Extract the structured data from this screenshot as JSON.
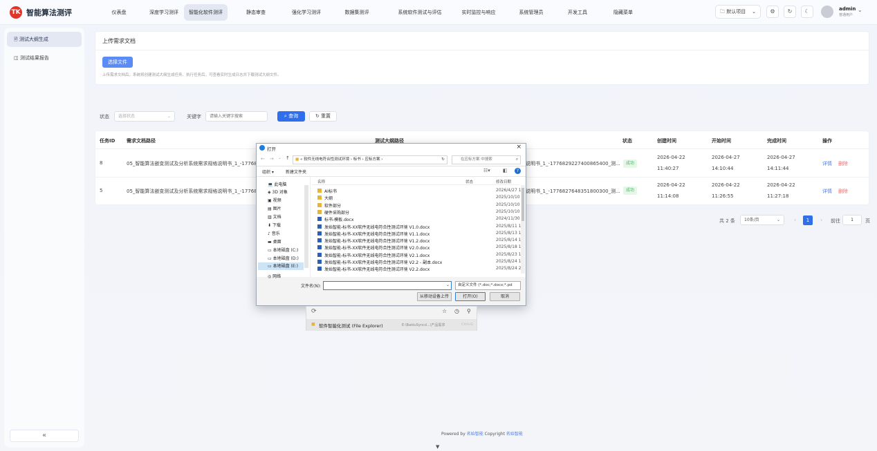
{
  "app": {
    "logo_text": "TK",
    "title": "智能算法测评"
  },
  "nav": [
    "仪表盘",
    "深度学习测评",
    "智能化软件测评",
    "静态审查",
    "强化学习测评",
    "数据集测评",
    "系统软件测试与评估",
    "实时监控与响应",
    "系统管理员",
    "开发工具",
    "隐藏菜单"
  ],
  "nav_active": "智能化软件测评",
  "project": {
    "label": "默认项目",
    "icon": "folder-icon"
  },
  "user": {
    "name": "admin",
    "role": "普通用户"
  },
  "sidebar": {
    "items": [
      "测试大纲生成",
      "测试结果报告"
    ],
    "collapse": "«"
  },
  "upload": {
    "title": "上传需求文档",
    "button": "选择文件",
    "hint": "上传需求文档后，系统将创建测试大纲生成任务、执行任务后，可查看实时生成日志并下载测试大纲文件。"
  },
  "filters": {
    "status_label": "状态",
    "status_placeholder": "选择状态",
    "keyword_label": "关键字",
    "keyword_placeholder": "请输入关键字搜索",
    "search": "查询",
    "reset": "重置"
  },
  "table": {
    "headers": [
      "任务ID",
      "需求文档路径",
      "测试大纲路径",
      "状态",
      "创建时间",
      "开始时间",
      "完成时间",
      "操作"
    ],
    "rows": [
      {
        "id": "8",
        "req": "05_智能算法嵌变测试及分析系统需求规格说明书_1_-17768",
        "outline_tail": "说明书_1_-1776829227400865400_测...",
        "status": "成功",
        "created_date": "2026-04-22",
        "created_time": "11:40:27",
        "start_date": "2026-04-27",
        "start_time": "14:10:44",
        "end_date": "2026-04-27",
        "end_time": "14:11:44",
        "detail": "详情",
        "delete": "删除"
      },
      {
        "id": "5",
        "req": "05_智能算法嵌变测试及分析系统需求规格说明书_1_-17768",
        "outline_tail": "说明书_1_-1776827648351800300_测...",
        "status": "成功",
        "created_date": "2026-04-22",
        "created_time": "11:14:08",
        "start_date": "2026-04-22",
        "start_time": "11:26:55",
        "end_date": "2026-04-22",
        "end_time": "11:27:18",
        "detail": "详情",
        "delete": "删除"
      }
    ]
  },
  "pager": {
    "total": "共 2 条",
    "size": "10条/页",
    "current": "1",
    "goto": "前往",
    "page_input": "1",
    "page_unit": "页"
  },
  "footer": {
    "powered": "Powered by",
    "brand1": "名始智能",
    "copyright": "Copyright",
    "brand2": "名始智能"
  },
  "dialog": {
    "title": "打开",
    "path": [
      "«",
      "软件无线电符合性测试环境",
      "标书",
      "应标方案"
    ],
    "search_placeholder": "在应标方案 中搜索",
    "organize": "组织 ▾",
    "new_folder": "新建文件夹",
    "tree": [
      "此电脑",
      "3D 对象",
      "视频",
      "图片",
      "文档",
      "下载",
      "音乐",
      "桌面",
      "本地磁盘 (C:)",
      "本地磁盘 (D:)",
      "本地磁盘 (E:)",
      "网络"
    ],
    "columns": [
      "名称",
      "状态",
      "修改日期"
    ],
    "files": [
      {
        "name": "AI标书",
        "date": "2026/4/27 1",
        "type": "folder"
      },
      {
        "name": "大纲",
        "date": "2025/10/10",
        "type": "folder"
      },
      {
        "name": "软件部分",
        "date": "2025/10/10",
        "type": "folder"
      },
      {
        "name": "硬件采购部分",
        "date": "2025/10/10",
        "type": "folder"
      },
      {
        "name": "标书-模板.docx",
        "date": "2024/11/30",
        "type": "doc"
      },
      {
        "name": "发始智能-标书-XX软件无线电符合性测试环境 V1.0.docx",
        "date": "2025/8/11 1",
        "type": "doc"
      },
      {
        "name": "发始智能-标书-XX软件无线电符合性测试环境 V1.1.docx",
        "date": "2025/8/13 1",
        "type": "doc"
      },
      {
        "name": "发始智能-标书-XX软件无线电符合性测试环境 V1.2.docx",
        "date": "2025/8/14 1",
        "type": "doc"
      },
      {
        "name": "发始智能-标书-XX软件无线电符合性测试环境 V2.0.docx",
        "date": "2025/8/18 1",
        "type": "doc"
      },
      {
        "name": "发始智能-标书-XX软件无线电符合性测试环境 V2.1.docx",
        "date": "2025/8/23 1",
        "type": "doc"
      },
      {
        "name": "发始智能-标书-XX软件无线电符合性测试环境 V2.2 - 副本.docx",
        "date": "2025/8/24 1",
        "type": "doc"
      },
      {
        "name": "发始智能-标书-XX软件无线电符合性测试环境 V2.2.docx",
        "date": "2025/8/24 2",
        "type": "doc"
      }
    ],
    "filename_label": "文件名(N):",
    "filetype": "自定义文件 (*.doc;*.docx;*.pd",
    "mobile_upload": "从移动设备上传",
    "open": "打开(O)",
    "cancel": "取消"
  },
  "suggest": {
    "item": "软件智能化测试 (File Explorer)",
    "path": "E:\\BaiduSyncd...\\产品需求",
    "shortcut": "Ctrl+G"
  }
}
